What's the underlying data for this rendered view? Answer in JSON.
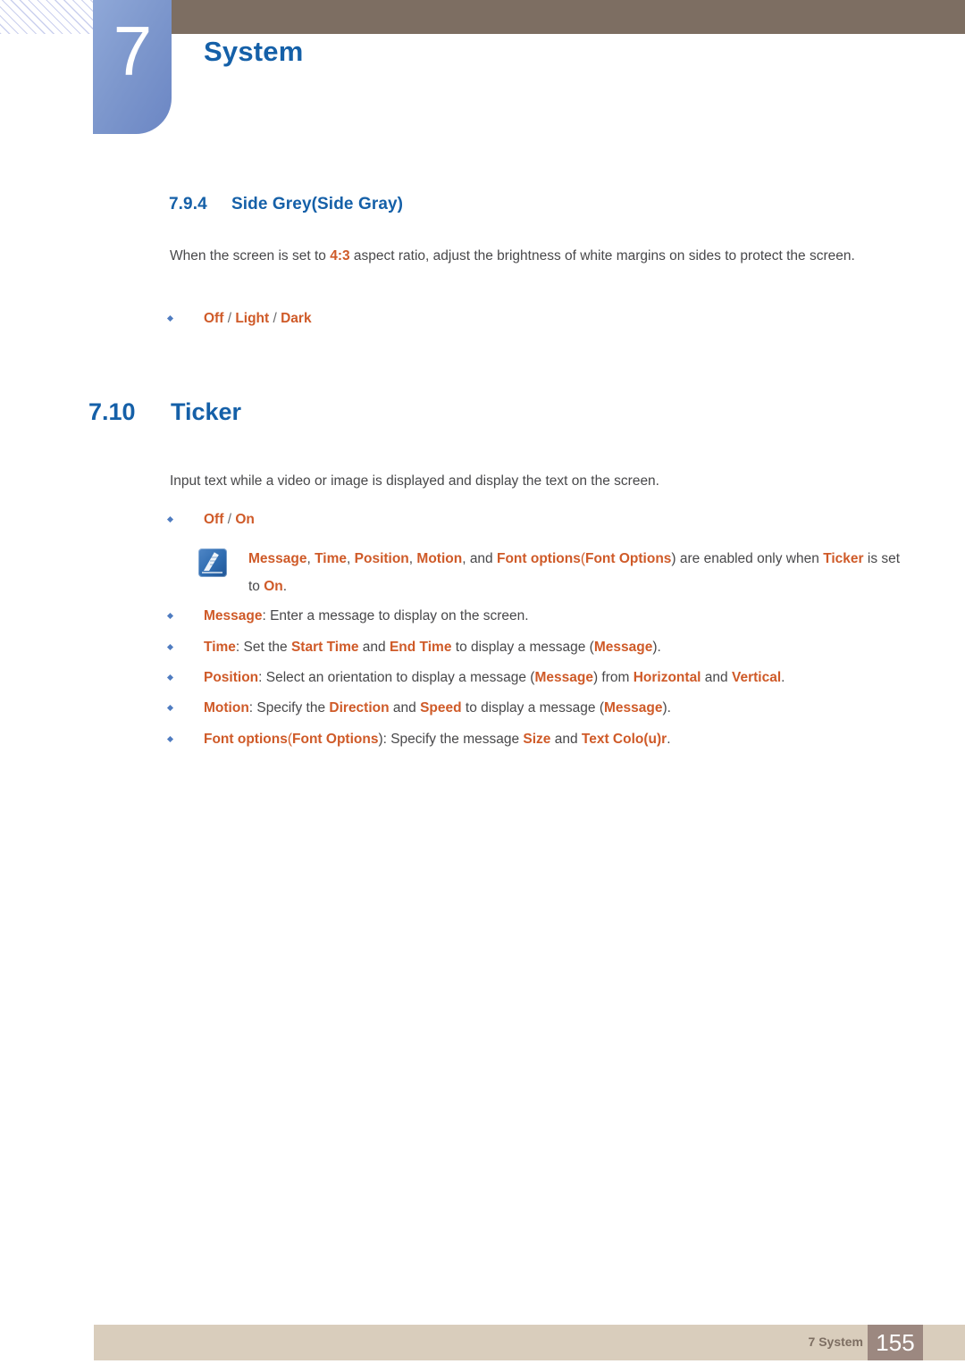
{
  "header": {
    "chapter_number": "7",
    "chapter_title": "System"
  },
  "sections": {
    "sub_heading": {
      "number": "7.9.4",
      "title": "Side Grey(Side Gray)"
    },
    "side_grey_paragraph": {
      "text_before": "When the screen is set to ",
      "highlight": "4:3",
      "text_after": " aspect ratio, adjust the brightness of white margins on sides to protect the screen."
    },
    "side_grey_options": {
      "opt1": "Off",
      "sep1": " / ",
      "opt2": "Light",
      "sep2": " / ",
      "opt3": "Dark"
    },
    "main_heading": {
      "number": "7.10",
      "title": "Ticker"
    },
    "ticker_paragraph": "Input text while a video or image is displayed and display the text on the screen.",
    "ticker_options": {
      "opt1": "Off",
      "sep1": " / ",
      "opt2": "On"
    },
    "note": {
      "icon": "note-pen-icon",
      "p1_a": "Message",
      "p1_b": ", ",
      "p1_c": "Time",
      "p1_d": ", ",
      "p1_e": "Position",
      "p1_f": ", ",
      "p1_g": "Motion",
      "p1_h": ", and ",
      "p1_i": "Font options",
      "p1_j": "(",
      "p1_k": "Font Options",
      "p1_l": ") are enabled only when ",
      "p1_m": "Ticker",
      "p1_n": " is set to ",
      "p1_o": "On",
      "p1_p": "."
    },
    "bullets": {
      "message": {
        "term": "Message",
        "rest": ": Enter a message to display on the screen."
      },
      "time": {
        "term": "Time",
        "r1": ": Set the ",
        "k1": "Start Time",
        "r2": " and ",
        "k2": "End Time",
        "r3": " to display a message (",
        "k3": "Message",
        "r4": ")."
      },
      "position": {
        "term": "Position",
        "r1": ": Select an orientation to display a message (",
        "k1": "Message",
        "r2": ") from ",
        "k2": "Horizontal",
        "r3": " and ",
        "k3": "Vertical",
        "r4": "."
      },
      "motion": {
        "term": "Motion",
        "r1": ": Specify the ",
        "k1": "Direction",
        "r2": " and ",
        "k2": "Speed",
        "r3": " to display a message (",
        "k3": "Message",
        "r4": ")."
      },
      "font_options": {
        "term": "Font options",
        "paren_open": "(",
        "term2": "Font Options",
        "r1": "): Specify the message ",
        "k1": "Size",
        "r2": " and ",
        "k2": "Text Colo(u)r",
        "r3": "."
      }
    }
  },
  "footer": {
    "label": "7 System",
    "page_number": "155"
  },
  "colors": {
    "heading_blue": "#1560a8",
    "accent_orange": "#cf5a28",
    "header_brown": "#7d6e62",
    "footer_beige": "#d9cdbc",
    "page_box_brown": "#9c8880",
    "tab_blue": "#7e98cd"
  }
}
